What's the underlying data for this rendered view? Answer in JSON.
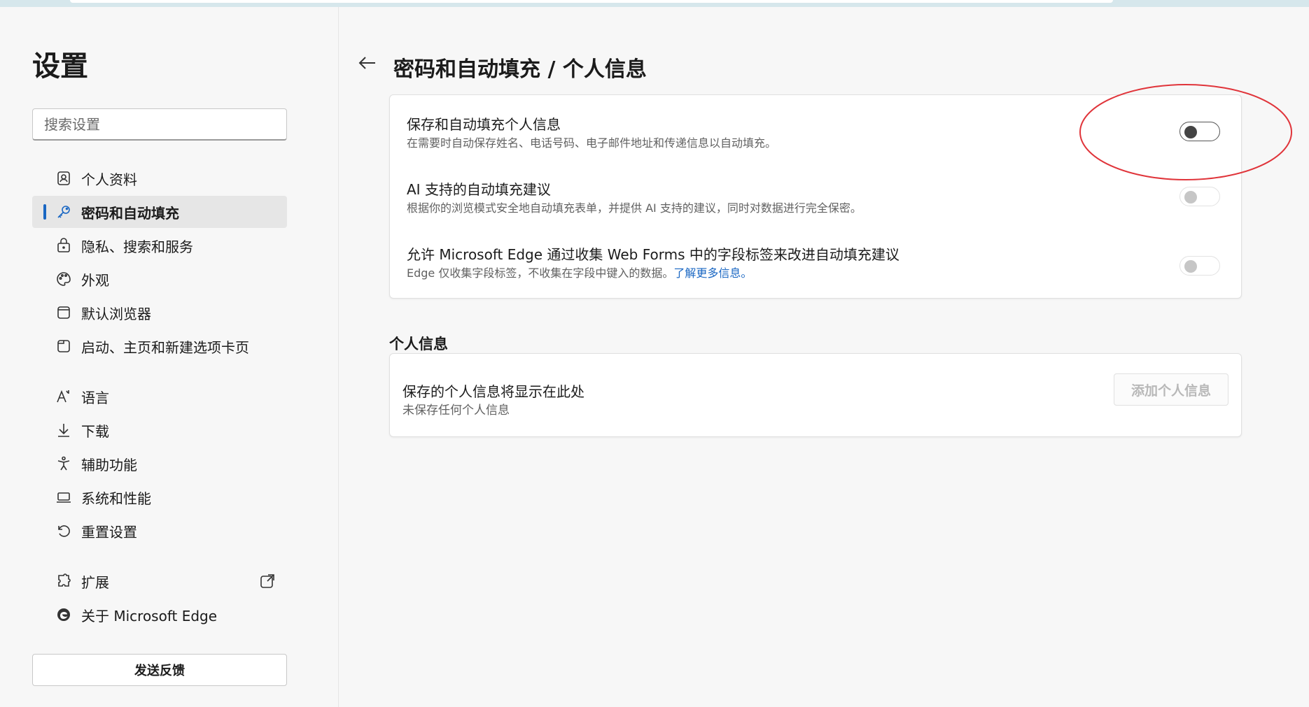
{
  "sidebar": {
    "title": "设置",
    "search_placeholder": "搜索设置",
    "items": [
      {
        "label": "个人资料",
        "icon": "profile-icon",
        "active": false
      },
      {
        "label": "密码和自动填充",
        "icon": "key-icon",
        "active": true
      },
      {
        "label": "隐私、搜索和服务",
        "icon": "lock-icon",
        "active": false
      },
      {
        "label": "外观",
        "icon": "palette-icon",
        "active": false
      },
      {
        "label": "默认浏览器",
        "icon": "browser-icon",
        "active": false
      },
      {
        "label": "启动、主页和新建选项卡页",
        "icon": "new-tab-icon",
        "active": false
      },
      {
        "label": "语言",
        "icon": "language-icon",
        "active": false
      },
      {
        "label": "下载",
        "icon": "download-icon",
        "active": false
      },
      {
        "label": "辅助功能",
        "icon": "accessibility-icon",
        "active": false
      },
      {
        "label": "系统和性能",
        "icon": "laptop-icon",
        "active": false
      },
      {
        "label": "重置设置",
        "icon": "reset-icon",
        "active": false
      },
      {
        "label": "扩展",
        "icon": "puzzle-icon",
        "active": false,
        "external": true
      },
      {
        "label": "关于 Microsoft Edge",
        "icon": "edge-logo-icon",
        "active": false
      }
    ],
    "feedback_label": "发送反馈"
  },
  "main": {
    "breadcrumb": "密码和自动填充 / 个人信息",
    "settings": [
      {
        "title": "保存和自动填充个人信息",
        "description": "在需要时自动保存姓名、电话号码、电子邮件地址和传递信息以自动填充。",
        "toggle": "off",
        "enabled": true
      },
      {
        "title": "AI 支持的自动填充建议",
        "description": "根据你的浏览模式安全地自动填充表单，并提供 AI 支持的建议，同时对数据进行完全保密。",
        "toggle": "off",
        "enabled": false
      },
      {
        "title": "允许 Microsoft Edge 通过收集 Web Forms 中的字段标签来改进自动填充建议",
        "description": "Edge 仅收集字段标签，不收集在字段中键入的数据。",
        "link_text": "了解更多信息。",
        "toggle": "off",
        "enabled": false
      }
    ],
    "personal_info": {
      "section_title": "个人信息",
      "empty_title": "保存的个人信息将显示在此处",
      "empty_subtitle": "未保存任何个人信息",
      "add_button": "添加个人信息"
    }
  },
  "colors": {
    "accent": "#1a67c3",
    "annotation": "#e0343a"
  }
}
